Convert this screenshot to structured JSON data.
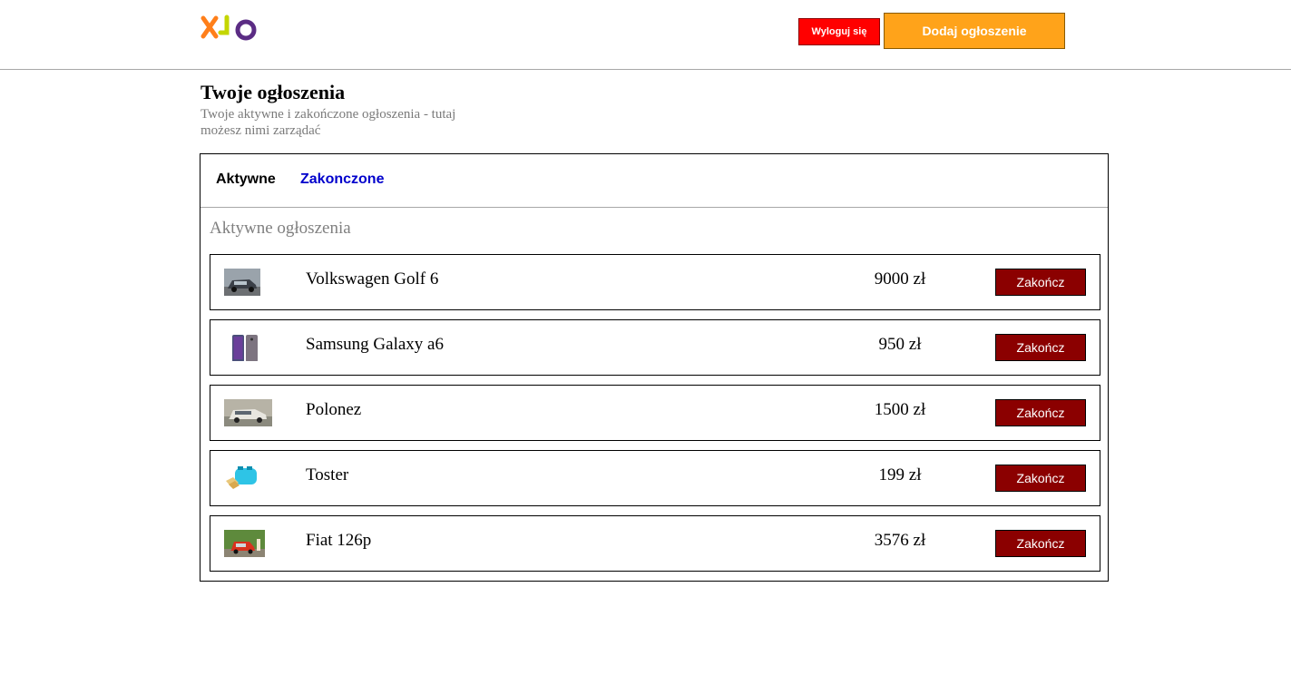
{
  "header": {
    "logo_icon": "olx-logo",
    "logout_label": "Wyloguj się",
    "add_label": "Dodaj ogłoszenie"
  },
  "page": {
    "title": "Twoje ogłoszenia",
    "subtitle": "Twoje aktywne i zakończone ogłoszenia - tutaj możesz nimi zarządać"
  },
  "tabs": [
    {
      "label": "Aktywne",
      "active": true
    },
    {
      "label": "Zakonczone",
      "active": false
    }
  ],
  "section_title": "Aktywne ogłoszenia",
  "listings": [
    {
      "title": "Volkswagen Golf 6",
      "price": "9000 zł",
      "action": "Zakończ",
      "thumb_icon": "car-photo"
    },
    {
      "title": "Samsung Galaxy a6",
      "price": "950 zł",
      "action": "Zakończ",
      "thumb_icon": "phone-photo"
    },
    {
      "title": "Polonez",
      "price": "1500 zł",
      "action": "Zakończ",
      "thumb_icon": "car-photo"
    },
    {
      "title": "Toster",
      "price": "199 zł",
      "action": "Zakończ",
      "thumb_icon": "toaster-photo"
    },
    {
      "title": "Fiat 126p",
      "price": "3576 zł",
      "action": "Zakończ",
      "thumb_icon": "car-photo"
    }
  ],
  "colors": {
    "logout_bg": "#ff0000",
    "add_bg": "#ffa31a",
    "end_bg": "#8b0000",
    "tab_link": "#0000cc"
  }
}
